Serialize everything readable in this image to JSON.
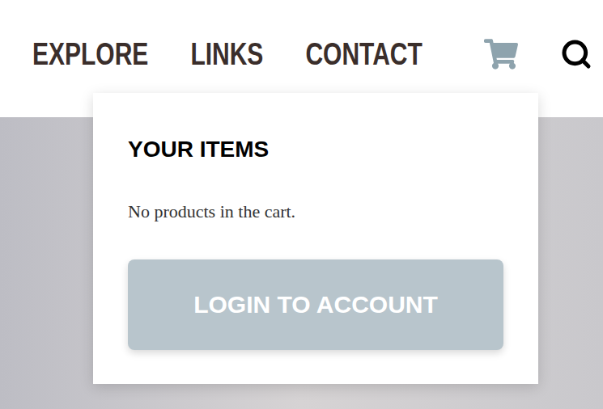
{
  "nav": {
    "items": [
      {
        "label": "EXPLORE"
      },
      {
        "label": "LINKS"
      },
      {
        "label": "CONTACT"
      }
    ]
  },
  "cart": {
    "title": "YOUR ITEMS",
    "empty_message": "No products in the cart.",
    "button": "LOGIN TO ACCOUNT"
  }
}
